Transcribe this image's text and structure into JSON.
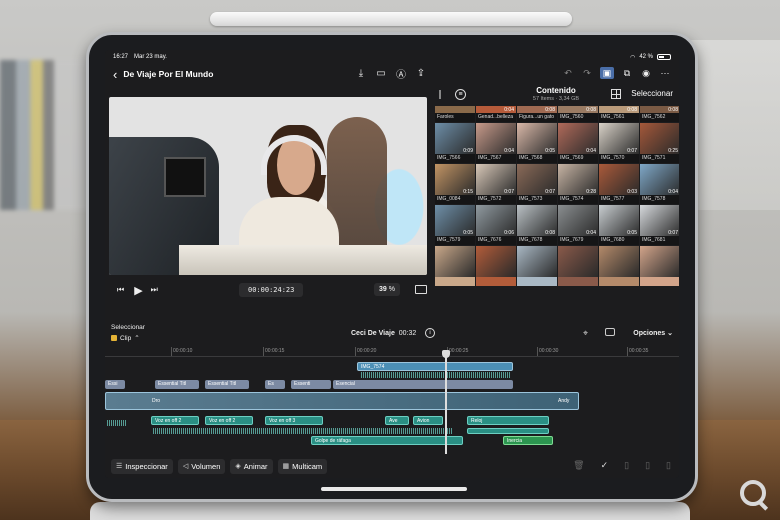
{
  "status": {
    "time": "16:27",
    "date": "Mar 23 may.",
    "battery": "42 %"
  },
  "nav": {
    "back": "‹",
    "title": "De Viaje Por El Mundo"
  },
  "viewer": {
    "timecode": "00:00:24:23",
    "zoom_value": "39",
    "zoom_unit": "%"
  },
  "browser": {
    "title": "Contenido",
    "subtitle": "57 ítems · 3,34 GB",
    "select_label": "Seleccionar",
    "clips": [
      {
        "name": "Faroles",
        "dur": "",
        "color": "#8a6a4a"
      },
      {
        "name": "Genad...belleza",
        "dur": "0:04",
        "color": "#b65b3a"
      },
      {
        "name": "Figura...un gato",
        "dur": "0:08",
        "color": "#a06a52"
      },
      {
        "name": "IMG_7560",
        "dur": "0:08",
        "color": "#9a7b63"
      },
      {
        "name": "IMG_7561",
        "dur": "0:08",
        "color": "#b99a7a"
      },
      {
        "name": "IMG_7562",
        "dur": "0:08",
        "color": "#7a5a44"
      },
      {
        "name": "IMG_7566",
        "dur": "0:09",
        "color": "#6d8ea8"
      },
      {
        "name": "IMG_7567",
        "dur": "0:04",
        "color": "#c79a8a"
      },
      {
        "name": "IMG_7568",
        "dur": "0:05",
        "color": "#d9b8a8"
      },
      {
        "name": "IMG_7569",
        "dur": "0:04",
        "color": "#b06a5a"
      },
      {
        "name": "IMG_7570",
        "dur": "0:07",
        "color": "#d9d2c8"
      },
      {
        "name": "IMG_7571",
        "dur": "0:25",
        "color": "#a4583a"
      },
      {
        "name": "IMG_0084",
        "dur": "0:15",
        "color": "#c29464"
      },
      {
        "name": "IMG_7572",
        "dur": "0:07",
        "color": "#d8c8b8"
      },
      {
        "name": "IMG_7573",
        "dur": "0:07",
        "color": "#8a6a58"
      },
      {
        "name": "IMG_7574",
        "dur": "0:28",
        "color": "#c7b4a4"
      },
      {
        "name": "IMG_7577",
        "dur": "0:03",
        "color": "#aa5a3a"
      },
      {
        "name": "IMG_7578",
        "dur": "0:04",
        "color": "#7fa8c8"
      },
      {
        "name": "IMG_7579",
        "dur": "0:05",
        "color": "#6e8fa8"
      },
      {
        "name": "IMG_7676",
        "dur": "0:06",
        "color": "#909aa0"
      },
      {
        "name": "IMG_7678",
        "dur": "0:08",
        "color": "#b9c0c4"
      },
      {
        "name": "IMG_7679",
        "dur": "0:04",
        "color": "#8a8e90"
      },
      {
        "name": "IMG_7680",
        "dur": "0:05",
        "color": "#c8cdd0"
      },
      {
        "name": "IMG_7681",
        "dur": "0:07",
        "color": "#d6d9dc"
      },
      {
        "name": "",
        "dur": "",
        "color": "#c9a88a"
      },
      {
        "name": "",
        "dur": "",
        "color": "#b25c3a"
      },
      {
        "name": "",
        "dur": "",
        "color": "#a9b8c4"
      },
      {
        "name": "",
        "dur": "",
        "color": "#8a5a4a"
      },
      {
        "name": "",
        "dur": "",
        "color": "#b48a6a"
      },
      {
        "name": "",
        "dur": "",
        "color": "#d2a48a"
      }
    ]
  },
  "timeline": {
    "select_label": "Seleccionar",
    "clip_label": "Clip",
    "project_name": "Ceci De Viaje",
    "project_duration": "00:32",
    "options_label": "Opciones",
    "ruler": [
      "00:00:10",
      "00:00:15",
      "00:00:20",
      "00:00:25",
      "00:00:30",
      "00:00:35"
    ],
    "clips": {
      "connected_top": "IMG_7574",
      "t1": "Essi",
      "t2": "Essential Titl",
      "t3": "Essential Titl",
      "t4": "Es",
      "t5": "Essenti",
      "t6": "Esencial",
      "main_a": "Dro",
      "main_b": "Andy",
      "a1": "Voz en off 2",
      "a2": "Voz en off 2",
      "a3": "Voz en off 3",
      "a4": "Ave",
      "a5": "Avion",
      "a6": "Reloj",
      "a7": "Golpe de ráfaga",
      "a8": "Inercia"
    }
  },
  "toolbar": {
    "inspector": "Inspeccionar",
    "volume": "Volumen",
    "animate": "Animar",
    "multicam": "Multicam"
  }
}
